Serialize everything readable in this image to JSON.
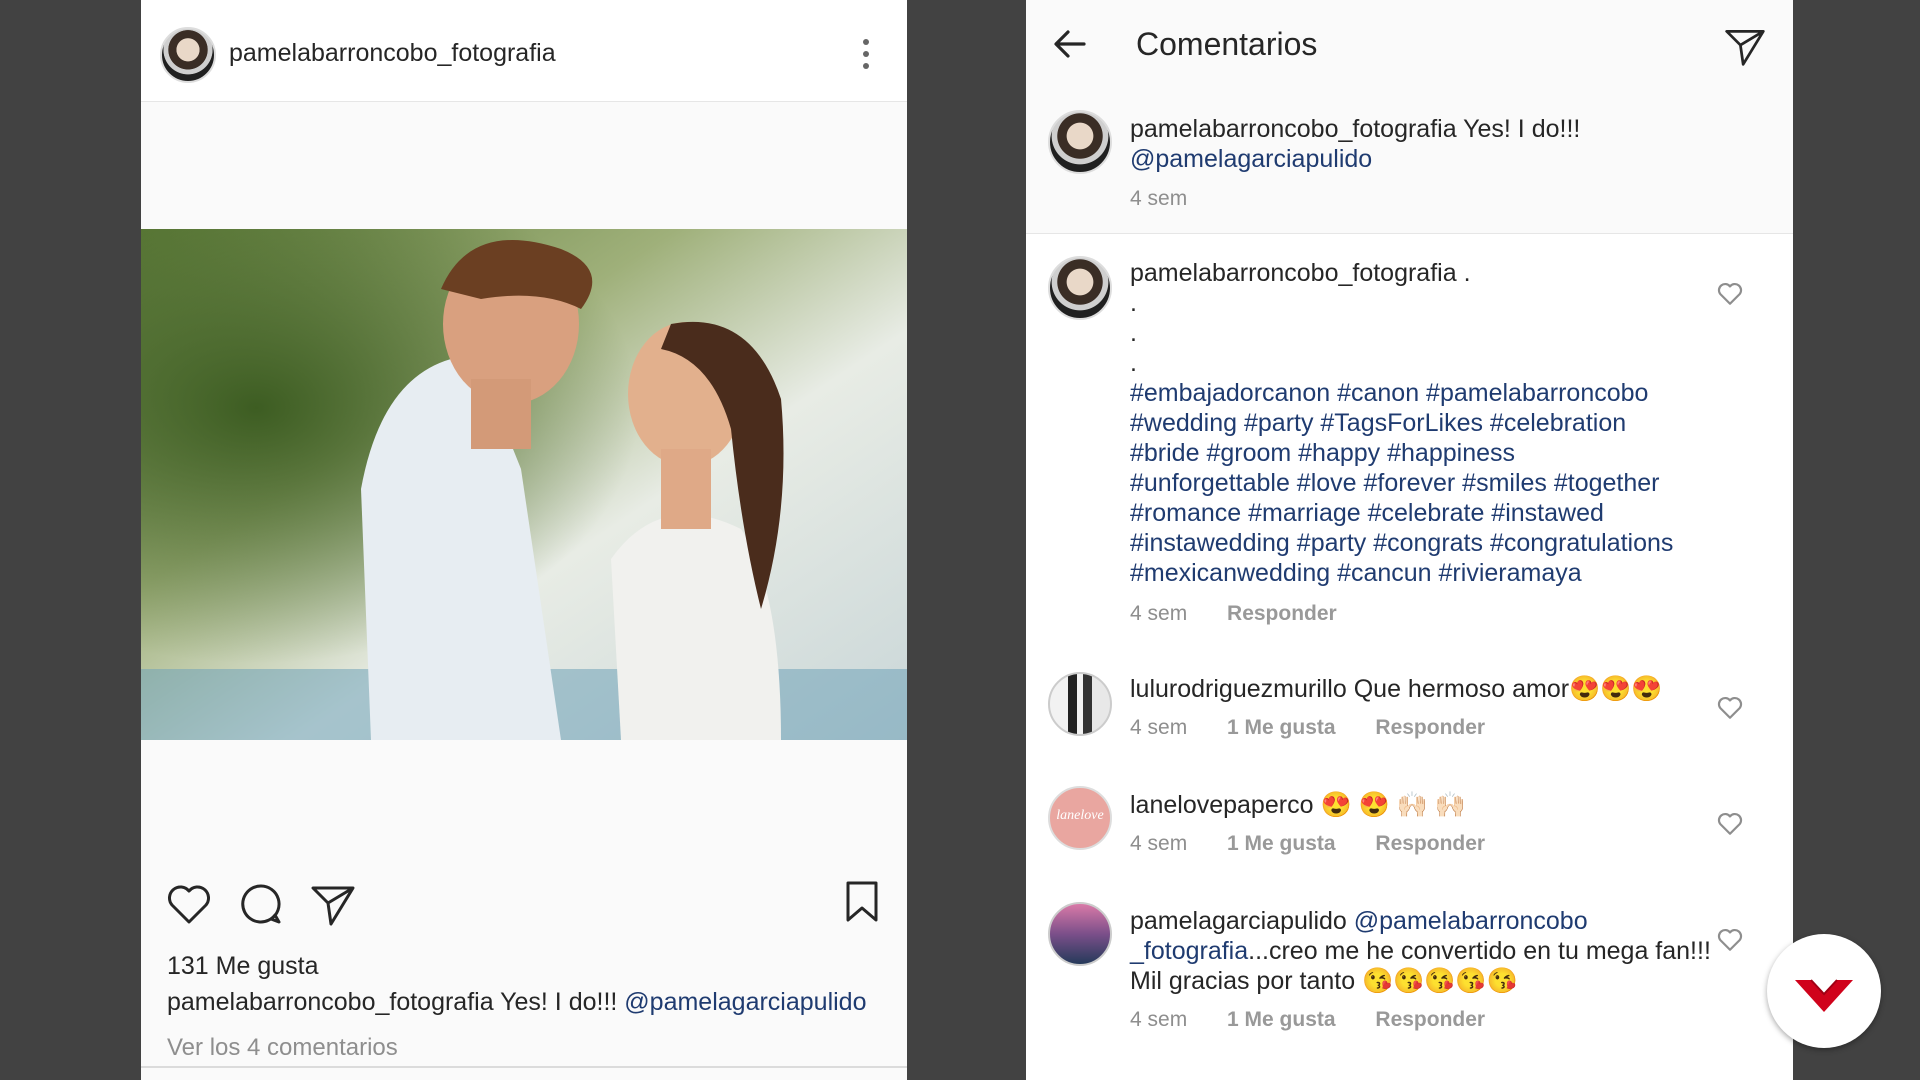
{
  "post": {
    "username": "pamelabarroncobo_fotografia",
    "likes": "131 Me gusta",
    "caption_user": "pamelabarroncobo_fotografia",
    "caption_text": "Yes! I do!!!",
    "caption_mention": "@pamelagarciapulido",
    "view_comments": "Ver los 4 comentarios"
  },
  "comments_screen": {
    "title": "Comentarios",
    "caption": {
      "user": "pamelabarroncobo_fotografia",
      "text": "Yes! I do!!!",
      "mention": "@pamelagarciapulido",
      "time": "4 sem"
    },
    "comments": [
      {
        "user": "pamelabarroncobo_fotografia",
        "text": ".",
        "dots": [
          ".",
          ".",
          "."
        ],
        "hashtag_lines": [
          "#embajadorcanon #canon  #pamelabarroncobo",
          "#wedding #party  #TagsForLikes #celebration",
          "#bride #groom  #happy #happiness",
          "#unforgettable #love #forever  #smiles #together",
          "#romance #marriage  #celebrate #instawed",
          "#instawedding #party #congrats #congratulations",
          "#mexicanwedding #cancun #rivieramaya"
        ],
        "time": "4 sem",
        "reply": "Responder"
      },
      {
        "user": "lulurodriguezmurillo",
        "text": "Que hermoso amor😍😍😍",
        "time": "4 sem",
        "likes": "1 Me gusta",
        "reply": "Responder"
      },
      {
        "user": "lanelovepaperco",
        "text": "😍 😍 🙌🏻 🙌🏻",
        "time": "4 sem",
        "likes": "1 Me gusta",
        "reply": "Responder",
        "avatar_text": "lanelove"
      },
      {
        "user": "pamelagarciapulido",
        "mention": "@pamelabarroncobo _fotografia",
        "text": "...creo me he convertido en tu mega fan!!! Mil gracias por tanto 😘😘😘😘😘",
        "time": "4 sem",
        "likes": "1 Me gusta",
        "reply": "Responder"
      }
    ]
  },
  "colors": {
    "background": "#424242",
    "mention": "#1f3b70",
    "meta": "#8e8e8e",
    "fab_logo": "#d0021b"
  },
  "icons": [
    "heart-icon",
    "comment-icon",
    "send-icon",
    "bookmark-icon",
    "more-icon",
    "back-arrow-icon",
    "like-heart-icon",
    "logo-icon"
  ]
}
